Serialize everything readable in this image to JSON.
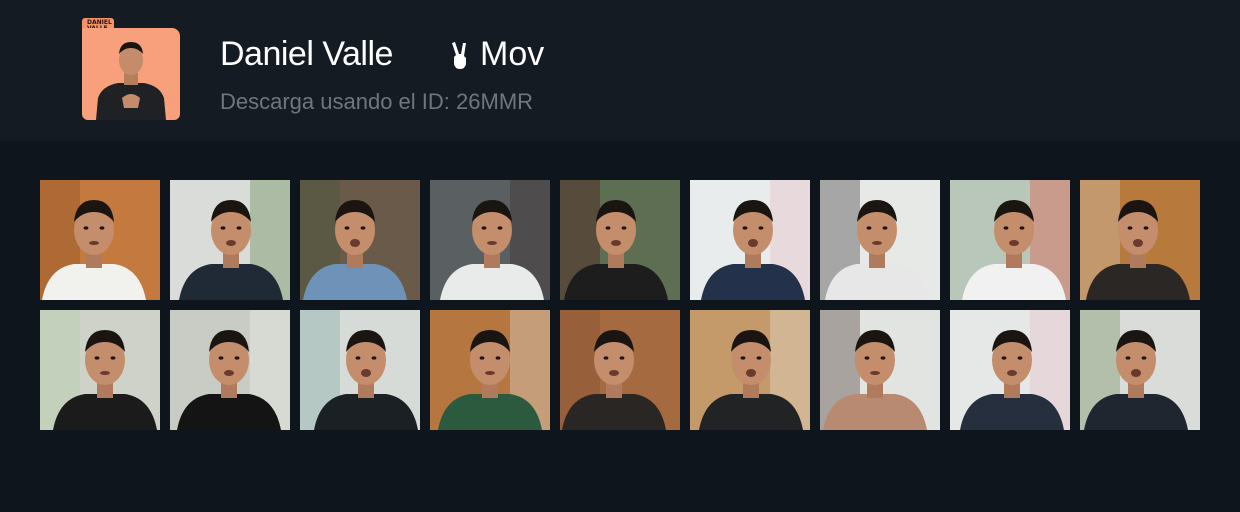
{
  "header": {
    "title": "Daniel Valle",
    "pack_name": "Mov",
    "pack_icon": "victory-hand-icon",
    "subtitle": "Descarga usando el ID: 26MMR",
    "folder_label_line1": "DANIEL",
    "folder_label_line2": "VALLE",
    "folder_color": "#f7a07b"
  },
  "gifs": [
    {
      "bg": "#c47a3e",
      "shirt": "#f1f1ee",
      "accent": "#8a4b24"
    },
    {
      "bg": "#d9dcd8",
      "shirt": "#1f2a36",
      "accent": "#5a7d45"
    },
    {
      "bg": "#6a5a4a",
      "shirt": "#6f93b8",
      "accent": "#3f5a3a"
    },
    {
      "bg": "#5a5f62",
      "shirt": "#e9eaea",
      "accent": "#3a2a25"
    },
    {
      "bg": "#5e6e52",
      "shirt": "#1d1d1d",
      "accent": "#4a0e14"
    },
    {
      "bg": "#e9ecec",
      "shirt": "#23324a",
      "accent": "#e8b6c2"
    },
    {
      "bg": "#e7e9e7",
      "shirt": "#e7e7e7",
      "accent": "#2a2a2a"
    },
    {
      "bg": "#b9c7ba",
      "shirt": "#f1f1f1",
      "accent": "#e84a3a"
    },
    {
      "bg": "#b77a3c",
      "shirt": "#2b2724",
      "accent": "#d8d0c5"
    },
    {
      "bg": "#cfd2c9",
      "shirt": "#1b1b1b",
      "accent": "#a8cfa4"
    },
    {
      "bg": "#c9ccc4",
      "shirt": "#141414",
      "accent": "#f0f0f0"
    },
    {
      "bg": "#d6dbd7",
      "shirt": "#1b2024",
      "accent": "#7aa6a0"
    },
    {
      "bg": "#b5773f",
      "shirt": "#2c5a3f",
      "accent": "#e6e6e6"
    },
    {
      "bg": "#a66a40",
      "shirt": "#2a2624",
      "accent": "#7a4a30"
    },
    {
      "bg": "#c49a6a",
      "shirt": "#222325",
      "accent": "#ede7de"
    },
    {
      "bg": "#e2e4e2",
      "shirt": "#b98a72",
      "accent": "#3c2a22"
    },
    {
      "bg": "#e6e8e7",
      "shirt": "#262f3e",
      "accent": "#e3b7c3"
    },
    {
      "bg": "#d9dcd9",
      "shirt": "#202630",
      "accent": "#6e8a55"
    }
  ]
}
